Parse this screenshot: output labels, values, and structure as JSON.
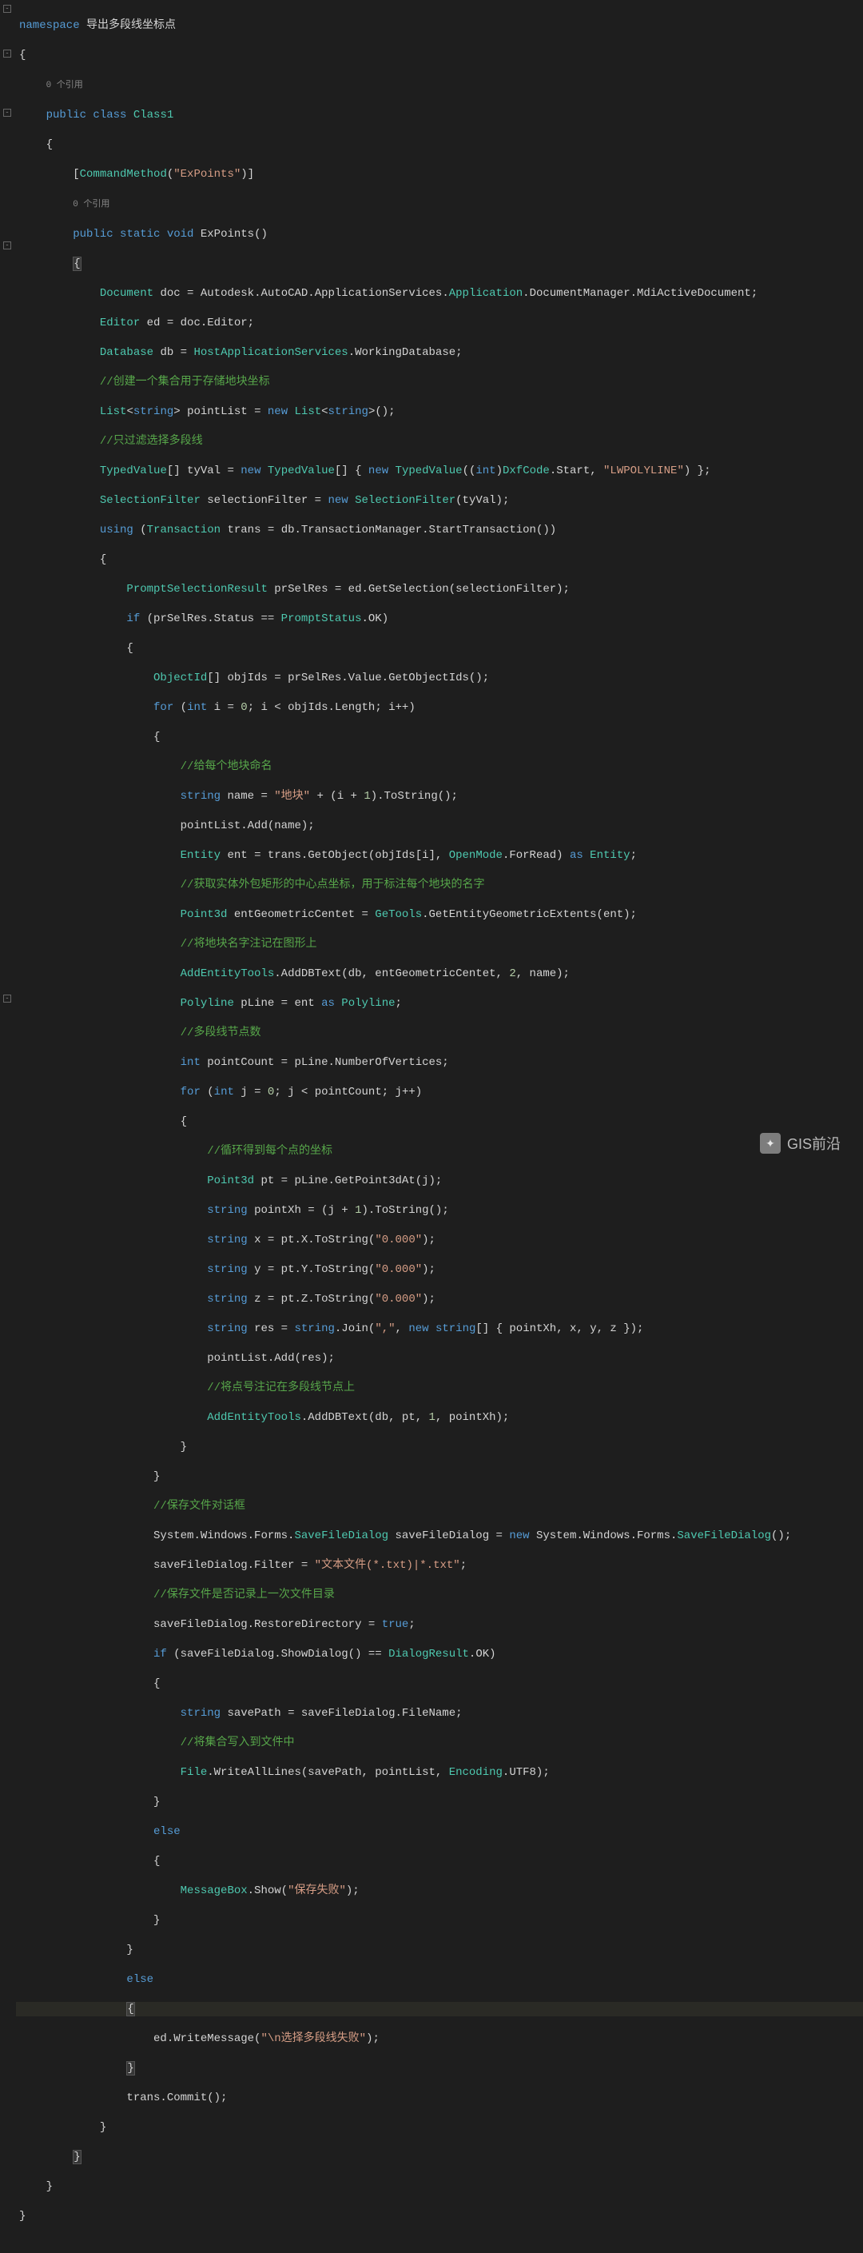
{
  "watermark": {
    "label": "GIS前沿"
  },
  "refs": {
    "ns_ref": "0 个引用",
    "class_ref": "0 个引用"
  },
  "c": {
    "l1a": "namespace",
    "l1b": " 导出多段线坐标点",
    "l2": "{",
    "l4a": "public",
    "l4b": " class",
    "l4c": " Class1",
    "l5": "{",
    "l6a": "[",
    "l6b": "CommandMethod",
    "l6c": "(",
    "l6d": "\"ExPoints\"",
    "l6e": ")]",
    "l8a": "public",
    "l8b": " static",
    "l8c": " void",
    "l8d": " ExPoints()",
    "l9": "{",
    "l10a": "Document",
    "l10b": " doc = ",
    "l10c": "Autodesk",
    "l10d": ".",
    "l10e": "AutoCAD",
    "l10f": ".",
    "l10g": "ApplicationServices",
    "l10h": ".",
    "l10i": "Application",
    "l10j": ".DocumentManager.MdiActiveDocument;",
    "l11a": "Editor",
    "l11b": " ed = doc.Editor;",
    "l12a": "Database",
    "l12b": " db = ",
    "l12c": "HostApplicationServices",
    "l12d": ".WorkingDatabase;",
    "l13": "//创建一个集合用于存储地块坐标",
    "l14a": "List",
    "l14b": "<",
    "l14c": "string",
    "l14d": "> pointList = ",
    "l14e": "new",
    "l14f": " List",
    "l14g": "<",
    "l14h": "string",
    "l14i": ">();",
    "l15": "//只过滤选择多段线",
    "l16a": "TypedValue",
    "l16b": "[] tyVal = ",
    "l16c": "new",
    "l16d": " TypedValue",
    "l16e": "[] { ",
    "l16f": "new",
    "l16g": " TypedValue",
    "l16h": "((",
    "l16i": "int",
    "l16j": ")",
    "l16k": "DxfCode",
    "l16l": ".Start, ",
    "l16m": "\"LWPOLYLINE\"",
    "l16n": ") };",
    "l17a": "SelectionFilter",
    "l17b": " selectionFilter = ",
    "l17c": "new",
    "l17d": " SelectionFilter",
    "l17e": "(tyVal);",
    "l18a": "using",
    "l18b": " (",
    "l18c": "Transaction",
    "l18d": " trans = db.TransactionManager.StartTransaction())",
    "l19": "{",
    "l20a": "PromptSelectionResult",
    "l20b": " prSelRes = ed.GetSelection(selectionFilter);",
    "l21a": "if",
    "l21b": " (prSelRes.Status == ",
    "l21c": "PromptStatus",
    "l21d": ".OK)",
    "l22": "{",
    "l23a": "ObjectId",
    "l23b": "[] objIds = prSelRes.Value.GetObjectIds();",
    "l24a": "for",
    "l24b": " (",
    "l24c": "int",
    "l24d": " i = ",
    "l24e": "0",
    "l24f": "; i < objIds.Length; i++)",
    "l25": "{",
    "l26": "//给每个地块命名",
    "l27a": "string",
    "l27b": " name = ",
    "l27c": "\"地块\"",
    "l27d": " + (i + ",
    "l27e": "1",
    "l27f": ").ToString();",
    "l28": "pointList.Add(name);",
    "l29a": "Entity",
    "l29b": " ent = trans.GetObject(objIds[i], ",
    "l29c": "OpenMode",
    "l29d": ".ForRead) ",
    "l29e": "as",
    "l29f": " Entity",
    "l29g": ";",
    "l30": "//获取实体外包矩形的中心点坐标，用于标注每个地块的名字",
    "l31a": "Point3d",
    "l31b": " entGeometricCentet = ",
    "l31c": "GeTools",
    "l31d": ".GetEntityGeometricExtents(ent);",
    "l32": "//将地块名字注记在图形上",
    "l33a": "AddEntityTools",
    "l33b": ".AddDBText(db, entGeometricCentet, ",
    "l33c": "2",
    "l33d": ", name);",
    "l34a": "Polyline",
    "l34b": " pLine = ent ",
    "l34c": "as",
    "l34d": " Polyline",
    "l34e": ";",
    "l35": "//多段线节点数",
    "l36a": "int",
    "l36b": " pointCount = pLine.NumberOfVertices;",
    "l37a": "for",
    "l37b": " (",
    "l37c": "int",
    "l37d": " j = ",
    "l37e": "0",
    "l37f": "; j < pointCount; j++)",
    "l38": "{",
    "l39": "//循环得到每个点的坐标",
    "l40a": "Point3d",
    "l40b": " pt = pLine.GetPoint3dAt(j);",
    "l41a": "string",
    "l41b": " pointXh = (j + ",
    "l41c": "1",
    "l41d": ").ToString();",
    "l42a": "string",
    "l42b": " x = pt.X.ToString(",
    "l42c": "\"0.000\"",
    "l42d": ");",
    "l43a": "string",
    "l43b": " y = pt.Y.ToString(",
    "l43c": "\"0.000\"",
    "l43d": ");",
    "l44a": "string",
    "l44b": " z = pt.Z.ToString(",
    "l44c": "\"0.000\"",
    "l44d": ");",
    "l45a": "string",
    "l45b": " res = ",
    "l45c": "string",
    "l45d": ".Join(",
    "l45e": "\",\"",
    "l45f": ", ",
    "l45g": "new",
    "l45h": " string",
    "l45i": "[] { pointXh, x, y, z });",
    "l46": "pointList.Add(res);",
    "l47": "//将点号注记在多段线节点上",
    "l48a": "AddEntityTools",
    "l48b": ".AddDBText(db, pt, ",
    "l48c": "1",
    "l48d": ", pointXh);",
    "l49": "}",
    "l50": "}",
    "l51": "//保存文件对话框",
    "l52a": "System.Windows.Forms.",
    "l52b": "SaveFileDialog",
    "l52c": " saveFileDialog = ",
    "l52d": "new",
    "l52e": " System.Windows.Forms.",
    "l52f": "SaveFileDialog",
    "l52g": "();",
    "l53a": "saveFileDialog.Filter = ",
    "l53b": "\"文本文件(*.txt)|*.txt\"",
    "l53c": ";",
    "l54": "//保存文件是否记录上一次文件目录",
    "l55a": "saveFileDialog.RestoreDirectory = ",
    "l55b": "true",
    "l55c": ";",
    "l56a": "if",
    "l56b": " (saveFileDialog.ShowDialog() == ",
    "l56c": "DialogResult",
    "l56d": ".OK)",
    "l57": "{",
    "l58a": "string",
    "l58b": " savePath = saveFileDialog.FileName;",
    "l59": "//将集合写入到文件中",
    "l60a": "File",
    "l60b": ".WriteAllLines(savePath, pointList, ",
    "l60c": "Encoding",
    "l60d": ".UTF8);",
    "l61": "}",
    "l62": "else",
    "l63": "{",
    "l64a": "MessageBox",
    "l64b": ".Show(",
    "l64c": "\"保存失败\"",
    "l64d": ");",
    "l65": "}",
    "l66": "}",
    "l67": "else",
    "l68": "{",
    "l69a": "ed.WriteMessage(",
    "l69b": "\"\\n选择多段线失败\"",
    "l69c": ");",
    "l70": "}",
    "l71": "trans.Commit();",
    "l72": "}",
    "l73": "}",
    "l74": "}",
    "l75": "}"
  }
}
